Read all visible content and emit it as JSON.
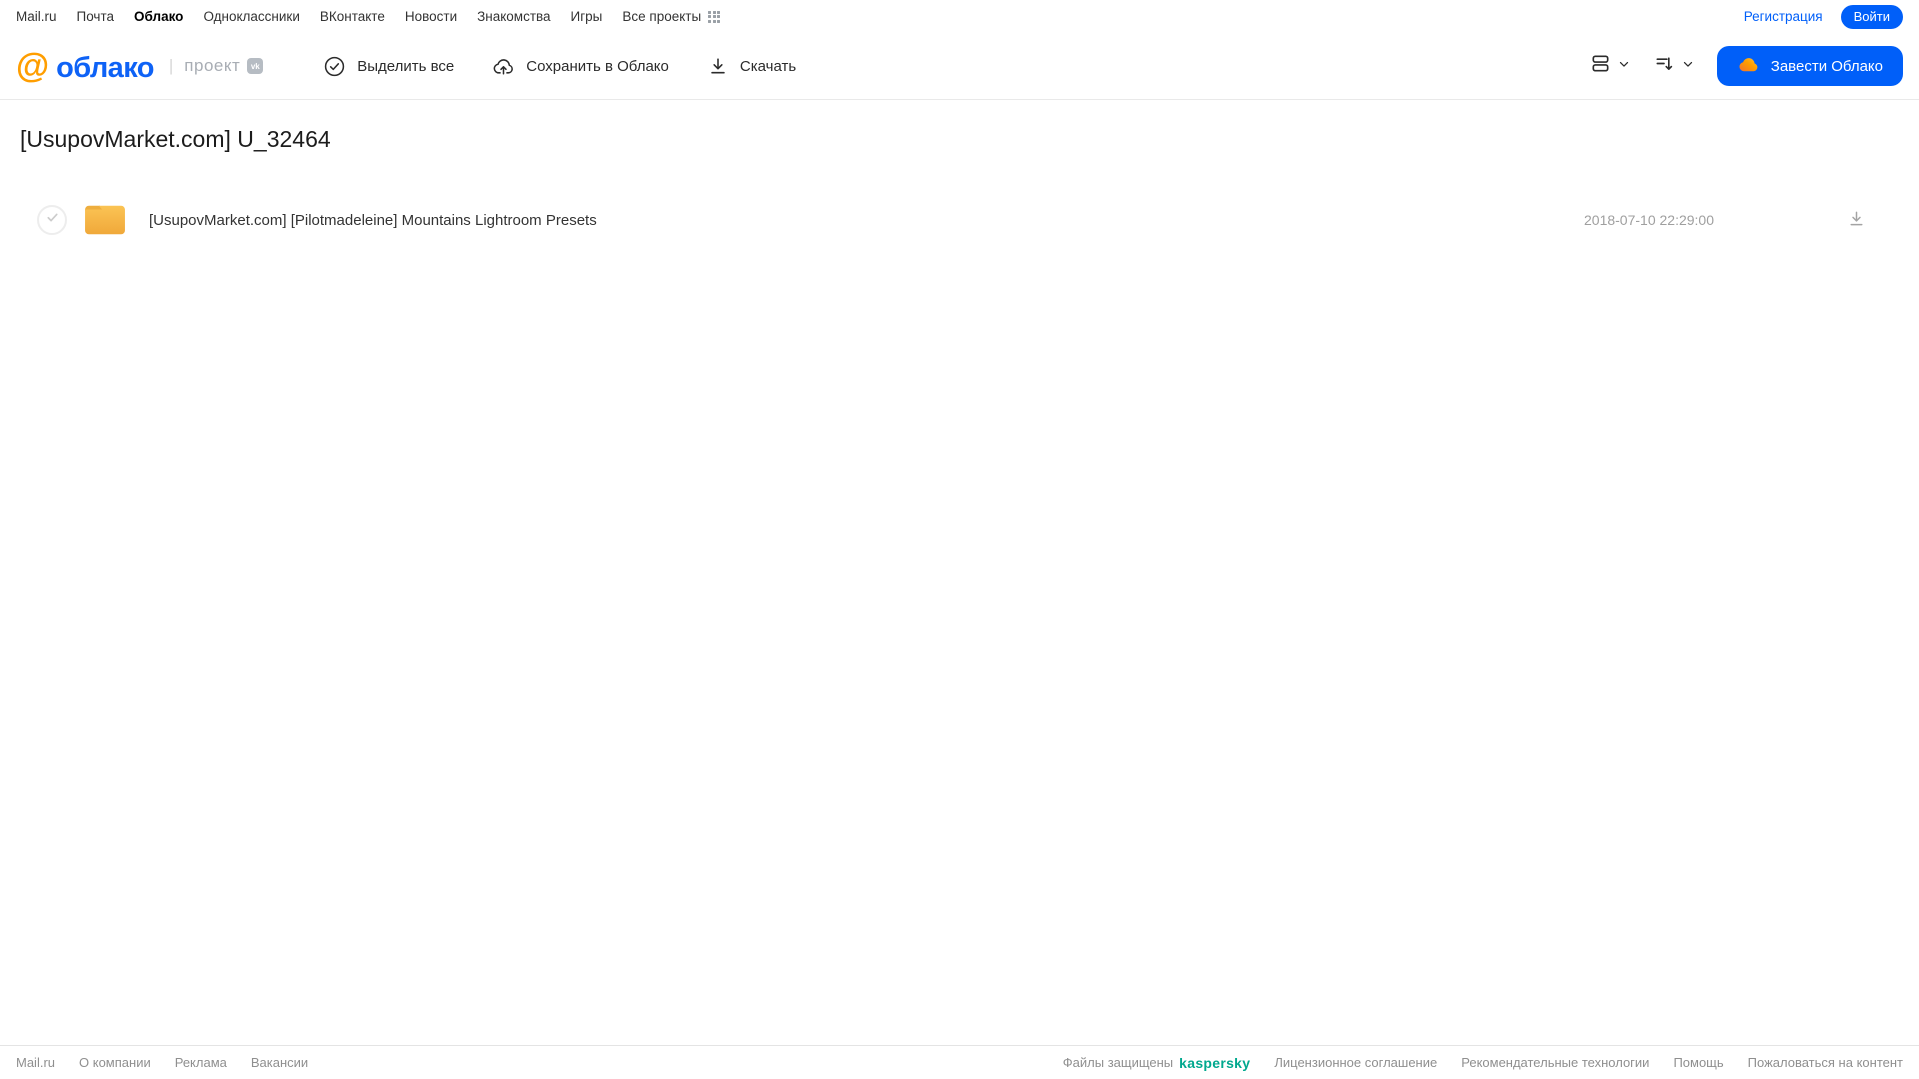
{
  "top_nav": {
    "links": [
      "Mail.ru",
      "Почта",
      "Облако",
      "Одноклассники",
      "ВКонтакте",
      "Новости",
      "Знакомства",
      "Игры",
      "Все проекты"
    ],
    "registration": "Регистрация",
    "login": "Войти"
  },
  "header": {
    "logo_at": "@",
    "logo_text": "облако",
    "project_label": "проект",
    "vk_badge": "vk",
    "toolbar": {
      "select_all": "Выделить все",
      "save_to_cloud": "Сохранить в Облако",
      "download": "Скачать"
    },
    "get_cloud_button": "Завести Облако"
  },
  "main": {
    "title": "[UsupovMarket.com] U_32464",
    "files": [
      {
        "type": "folder",
        "name": "[UsupovMarket.com] [Pilotmadeleine] Mountains Lightroom Presets",
        "date": "2018-07-10 22:29:00"
      }
    ]
  },
  "footer": {
    "left_links": [
      "Mail.ru",
      "О компании",
      "Реклама",
      "Вакансии"
    ],
    "protected_label": "Файлы защищены",
    "kaspersky": "kaspersky",
    "right_links": [
      "Лицензионное соглашение",
      "Рекомендательные технологии",
      "Помощь",
      "Пожаловаться на контент"
    ]
  },
  "colors": {
    "accent_blue": "#005ff9",
    "logo_orange": "#ff9e00",
    "folder_yellow": "#f6b64a",
    "kaspersky_green": "#00a88e"
  }
}
